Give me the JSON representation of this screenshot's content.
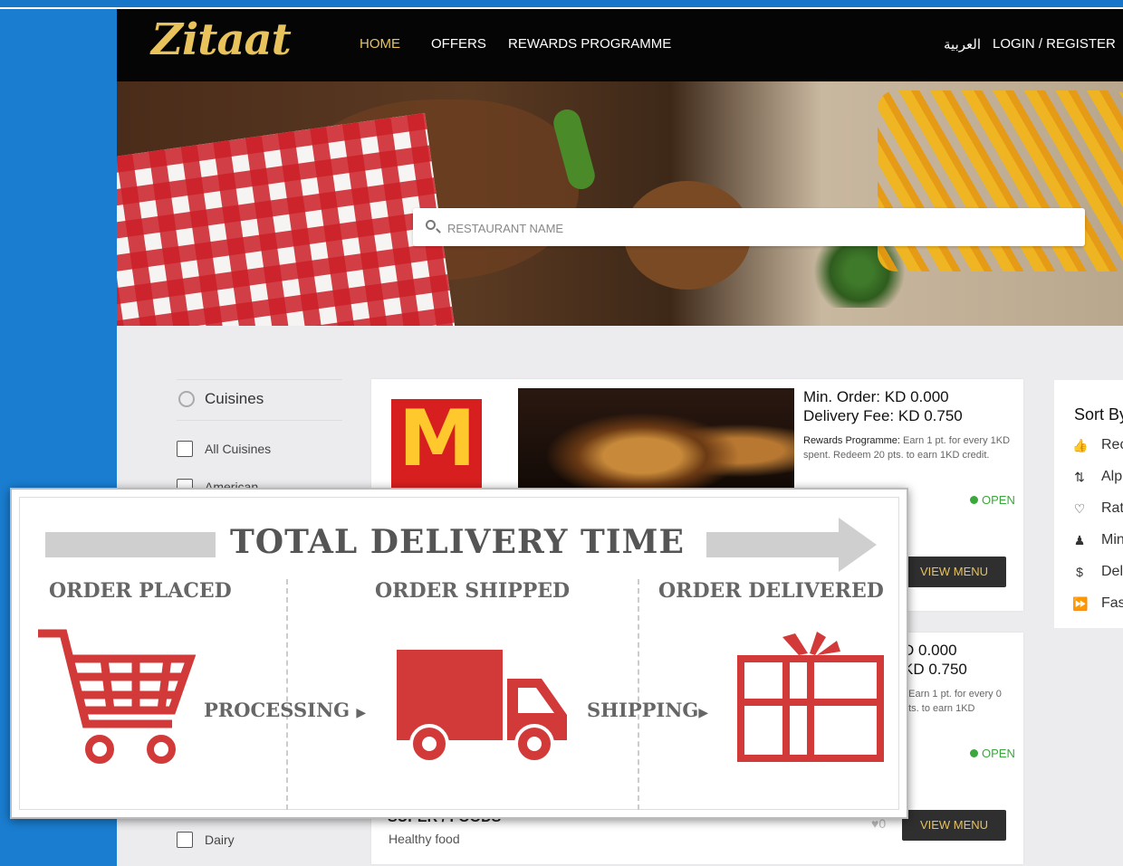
{
  "nav": {
    "logo": "Zitaat",
    "home": "HOME",
    "offers": "OFFERS",
    "rewards": "REWARDS PROGRAMME",
    "arabic": "العربية",
    "login": "LOGIN / REGISTER"
  },
  "search": {
    "placeholder": "RESTAURANT NAME"
  },
  "sidebar": {
    "title": "Cuisines",
    "items": [
      "All Cuisines",
      "American",
      "Dairy"
    ]
  },
  "cards": [
    {
      "min_order": "Min. Order: KD 0.000",
      "delivery_fee": "Delivery Fee: KD 0.750",
      "rewards_label": "Rewards Programme:",
      "rewards_text": " Earn 1 pt. for every 1KD spent. Redeem 20 pts. to earn 1KD credit.",
      "status": "OPEN",
      "button": "VIEW MENU",
      "logo": "M"
    },
    {
      "min_order": "D 0.000",
      "delivery_fee": "KD 0.750",
      "rewards_text": ": Earn 1 pt. for every 0 pts. to earn 1KD",
      "status": "OPEN",
      "button": "VIEW MENU",
      "name": "SUPER / FOODS",
      "subtitle": "Healthy food",
      "likes": "0"
    }
  ],
  "sort": {
    "title": "Sort By",
    "items": [
      {
        "label": "Rec",
        "icon": "thumbs-up-icon",
        "glyph": "👍"
      },
      {
        "label": "Alp",
        "icon": "sort-alpha-icon",
        "glyph": "⇅"
      },
      {
        "label": "Rat",
        "icon": "heart-icon",
        "glyph": "♡"
      },
      {
        "label": "Min",
        "icon": "user-icon",
        "glyph": "♟"
      },
      {
        "label": "Del",
        "icon": "dollar-icon",
        "glyph": "$"
      },
      {
        "label": "Fas",
        "icon": "fast-forward-icon",
        "glyph": "⏩"
      }
    ]
  },
  "overlay": {
    "title": "TOTAL DELIVERY TIME",
    "stages": [
      "ORDER PLACED",
      "ORDER SHIPPED",
      "ORDER DELIVERED"
    ],
    "flows": [
      "PROCESSING",
      "SHIPPING"
    ],
    "colors": {
      "icon": "#d23a3a",
      "arrow": "#cfcfcf",
      "text": "#666666"
    }
  },
  "colors": {
    "brand": "#e8c25a",
    "nav_bg": "#050505",
    "open": "#3aa83c",
    "frame": "#1a7dd0"
  }
}
